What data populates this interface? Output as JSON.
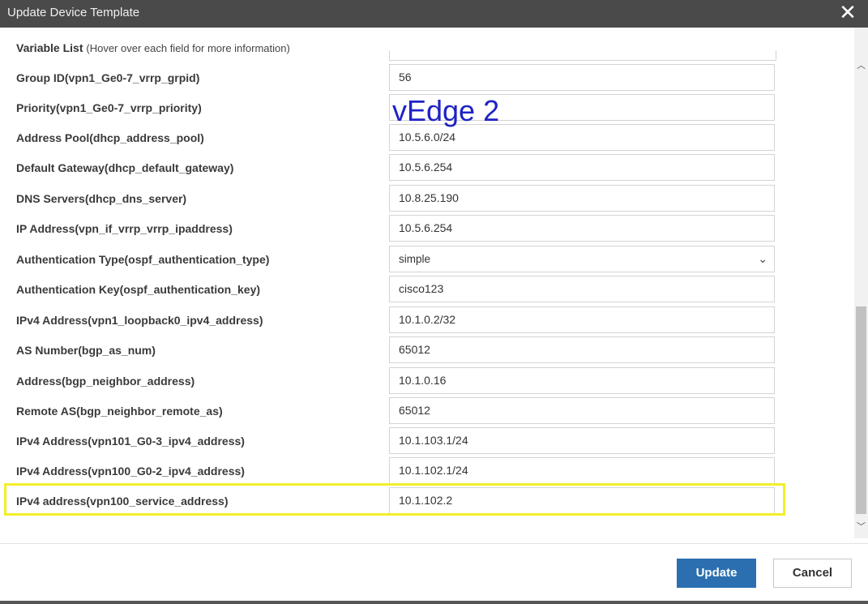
{
  "window": {
    "title": "Update Device Template"
  },
  "header": {
    "title": "Variable List",
    "hint": "(Hover over each field for more information)"
  },
  "annotation": "vEdge 2",
  "rows": [
    {
      "label": "Group ID(vpn1_Ge0-7_vrrp_grpid)",
      "value": "56"
    },
    {
      "label": "Priority(vpn1_Ge0-7_vrrp_priority)",
      "value": ""
    },
    {
      "label": "Address Pool(dhcp_address_pool)",
      "value": "10.5.6.0/24"
    },
    {
      "label": "Default Gateway(dhcp_default_gateway)",
      "value": "10.5.6.254"
    },
    {
      "label": "DNS Servers(dhcp_dns_server)",
      "value": "10.8.25.190"
    },
    {
      "label": "IP Address(vpn_if_vrrp_vrrp_ipaddress)",
      "value": "10.5.6.254"
    },
    {
      "label": "Authentication Type(ospf_authentication_type)",
      "value": "simple"
    },
    {
      "label": "Authentication Key(ospf_authentication_key)",
      "value": "cisco123"
    },
    {
      "label": "IPv4 Address(vpn1_loopback0_ipv4_address)",
      "value": "10.1.0.2/32"
    },
    {
      "label": "AS Number(bgp_as_num)",
      "value": "65012"
    },
    {
      "label": "Address(bgp_neighbor_address)",
      "value": "10.1.0.16"
    },
    {
      "label": "Remote AS(bgp_neighbor_remote_as)",
      "value": "65012"
    },
    {
      "label": "IPv4 Address(vpn101_G0-3_ipv4_address)",
      "value": "10.1.103.1/24"
    },
    {
      "label": "IPv4 Address(vpn100_G0-2_ipv4_address)",
      "value": "10.1.102.1/24"
    },
    {
      "label": "IPv4 address(vpn100_service_address)",
      "value": "10.1.102.2"
    }
  ],
  "buttons": {
    "update": "Update",
    "cancel": "Cancel"
  },
  "colors": {
    "accent": "#2b6fb0",
    "highlight": "#f2ee2a",
    "annotation": "#1f22c4",
    "titlebar": "#4a4a4a"
  }
}
